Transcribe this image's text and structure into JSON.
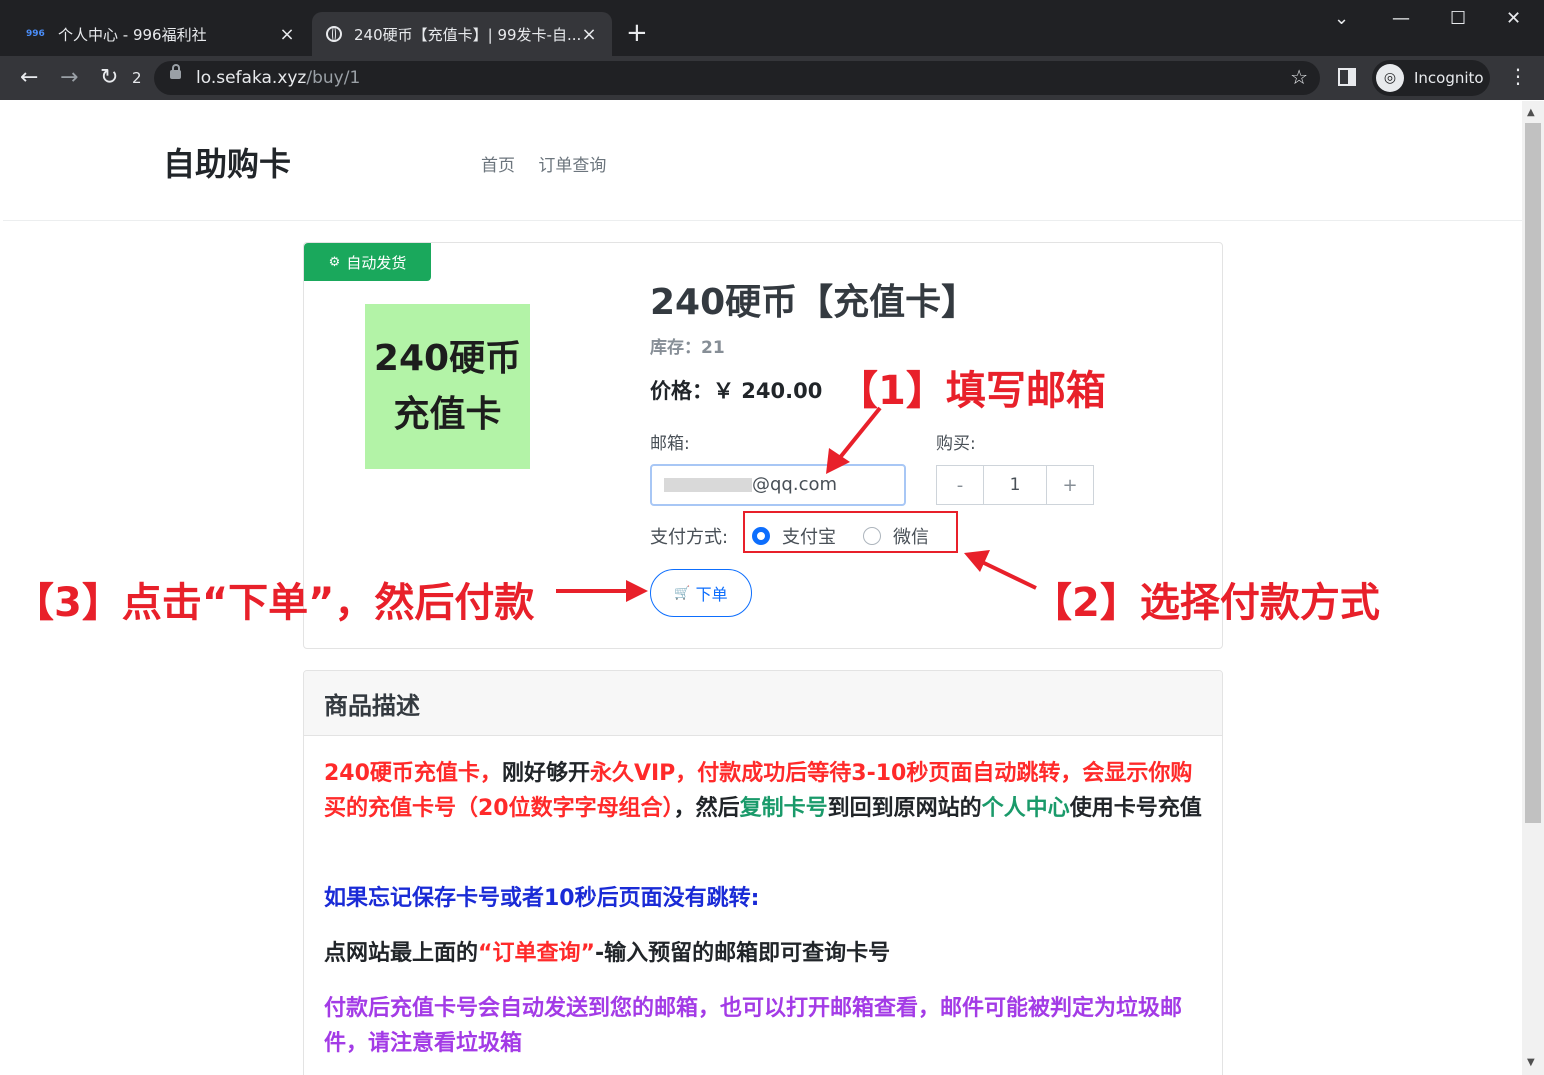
{
  "browser": {
    "tabs": [
      {
        "favicon": "996",
        "title": "个人中心 - 996福利社"
      },
      {
        "title": "240硬币【充值卡】| 99发卡-自..."
      }
    ],
    "refresh_count": "2",
    "url_host": "lo.sefaka.xyz",
    "url_path": "/buy/1",
    "profile": "Incognito"
  },
  "site": {
    "brand": "自助购卡",
    "nav": [
      "首页",
      "订单查询"
    ]
  },
  "product": {
    "badge": "自动发货",
    "image_line1": "240硬币",
    "image_line2": "充值卡",
    "title": "240硬币【充值卡】",
    "stock": "库存：21",
    "price": "价格：￥ 240.00",
    "email_label": "邮箱:",
    "email_value": "@qq.com",
    "qty_label": "购买:",
    "qty_minus": "-",
    "qty_value": "1",
    "qty_plus": "+",
    "pay_label": "支付方式:",
    "pay_options": [
      "支付宝",
      "微信"
    ],
    "pay_selected": "支付宝",
    "order_button": "下单"
  },
  "description": {
    "heading": "商品描述",
    "p1": [
      {
        "text": "240硬币充值卡，",
        "color": "red"
      },
      {
        "text": "刚好够开",
        "color": "dark"
      },
      {
        "text": "永久VIP，付款成功后等待3-10秒页面自动跳转，会显示你购买的充值卡号（20位数字字母组合）",
        "color": "red"
      },
      {
        "text": "，然后",
        "color": "dark"
      },
      {
        "text": "复制卡号",
        "color": "green"
      },
      {
        "text": "到回到原网站的",
        "color": "dark"
      },
      {
        "text": "个人中心",
        "color": "green"
      },
      {
        "text": "使用卡号充值",
        "color": "dark"
      }
    ],
    "p2": "如果忘记保存卡号或者10秒后页面没有跳转:",
    "p3_a": "点网站最上面的",
    "p3_b": "“订单查询”",
    "p3_c": "-输入预留的邮箱即可查询卡号",
    "p4": "付款后充值卡号会自动发送到您的邮箱，也可以打开邮箱查看，邮件可能被判定为垃圾邮件，请注意看垃圾箱"
  },
  "annotations": {
    "step1": "【1】填写邮箱",
    "step2": "【2】选择付款方式",
    "step3": "【3】点击“下单”，然后付款",
    "color": "#e8202a"
  }
}
